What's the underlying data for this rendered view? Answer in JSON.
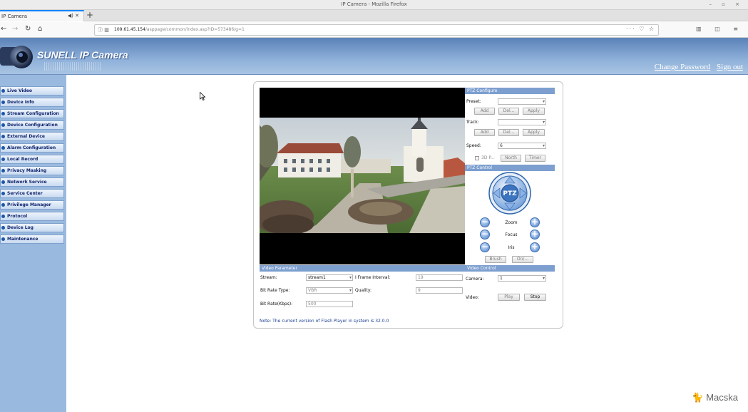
{
  "window": {
    "title": "IP Camera - Mozilla Firefox",
    "controls": "– ▫ ×"
  },
  "tab": {
    "label": "IP Camera"
  },
  "address": {
    "host": "109.61.45.154",
    "path": "/asppage/common/index.asp?ID=573486/g=1"
  },
  "header": {
    "brand": "SUNELL IP Camera",
    "change_password": "Change Password",
    "sign_out": "Sign out"
  },
  "sidebar": {
    "items": [
      {
        "label": "Live Video"
      },
      {
        "label": "Device Info"
      },
      {
        "label": "Stream Configuration"
      },
      {
        "label": "Device Configuration"
      },
      {
        "label": "External Device"
      },
      {
        "label": "Alarm Configuration"
      },
      {
        "label": "Local Record"
      },
      {
        "label": "Privacy Masking"
      },
      {
        "label": "Network Service"
      },
      {
        "label": "Service Center"
      },
      {
        "label": "Privilege Manager"
      },
      {
        "label": "Protocol"
      },
      {
        "label": "Device Log"
      },
      {
        "label": "Maintenance"
      }
    ]
  },
  "ptz_configure": {
    "title": "PTZ Configure",
    "preset_label": "Preset:",
    "track_label": "Track:",
    "speed_label": "Speed:",
    "speed_value": "6",
    "add": "Add",
    "del": "Del...",
    "apply": "Apply",
    "threed": "3D P...",
    "north": "North",
    "timer": "Timer"
  },
  "ptz_control": {
    "title": "PTZ Control",
    "center_label": "PTZ",
    "zoom": "Zoom",
    "focus": "Focus",
    "iris": "Iris",
    "brush": "Brush",
    "on": "On/...",
    "minus": "−",
    "plus": "+"
  },
  "video_parameter": {
    "title": "Video Parameter",
    "stream_label": "Stream:",
    "stream_value": "stream1",
    "iframe_label": "I Frame Interval:",
    "iframe_value": "19",
    "bitrate_type_label": "Bit Rate Type:",
    "bitrate_type_value": "VBR",
    "quality_label": "Quality:",
    "quality_value": "9",
    "bitrate_label": "Bit Rate(Kbps):",
    "bitrate_value": "500"
  },
  "video_control": {
    "title": "Video Control",
    "camera_label": "Camera:",
    "camera_value": "1",
    "video_label": "Video:",
    "play": "Play",
    "stop": "Stop"
  },
  "note": "Note: The current version of Flash Player in system is 32.0.0",
  "watermark": "Macska",
  "colors": {
    "banner": "#6f93c6",
    "sidebar": "#99b9df",
    "header_bar": "#7d9fcf",
    "menu_text": "#10246d"
  }
}
